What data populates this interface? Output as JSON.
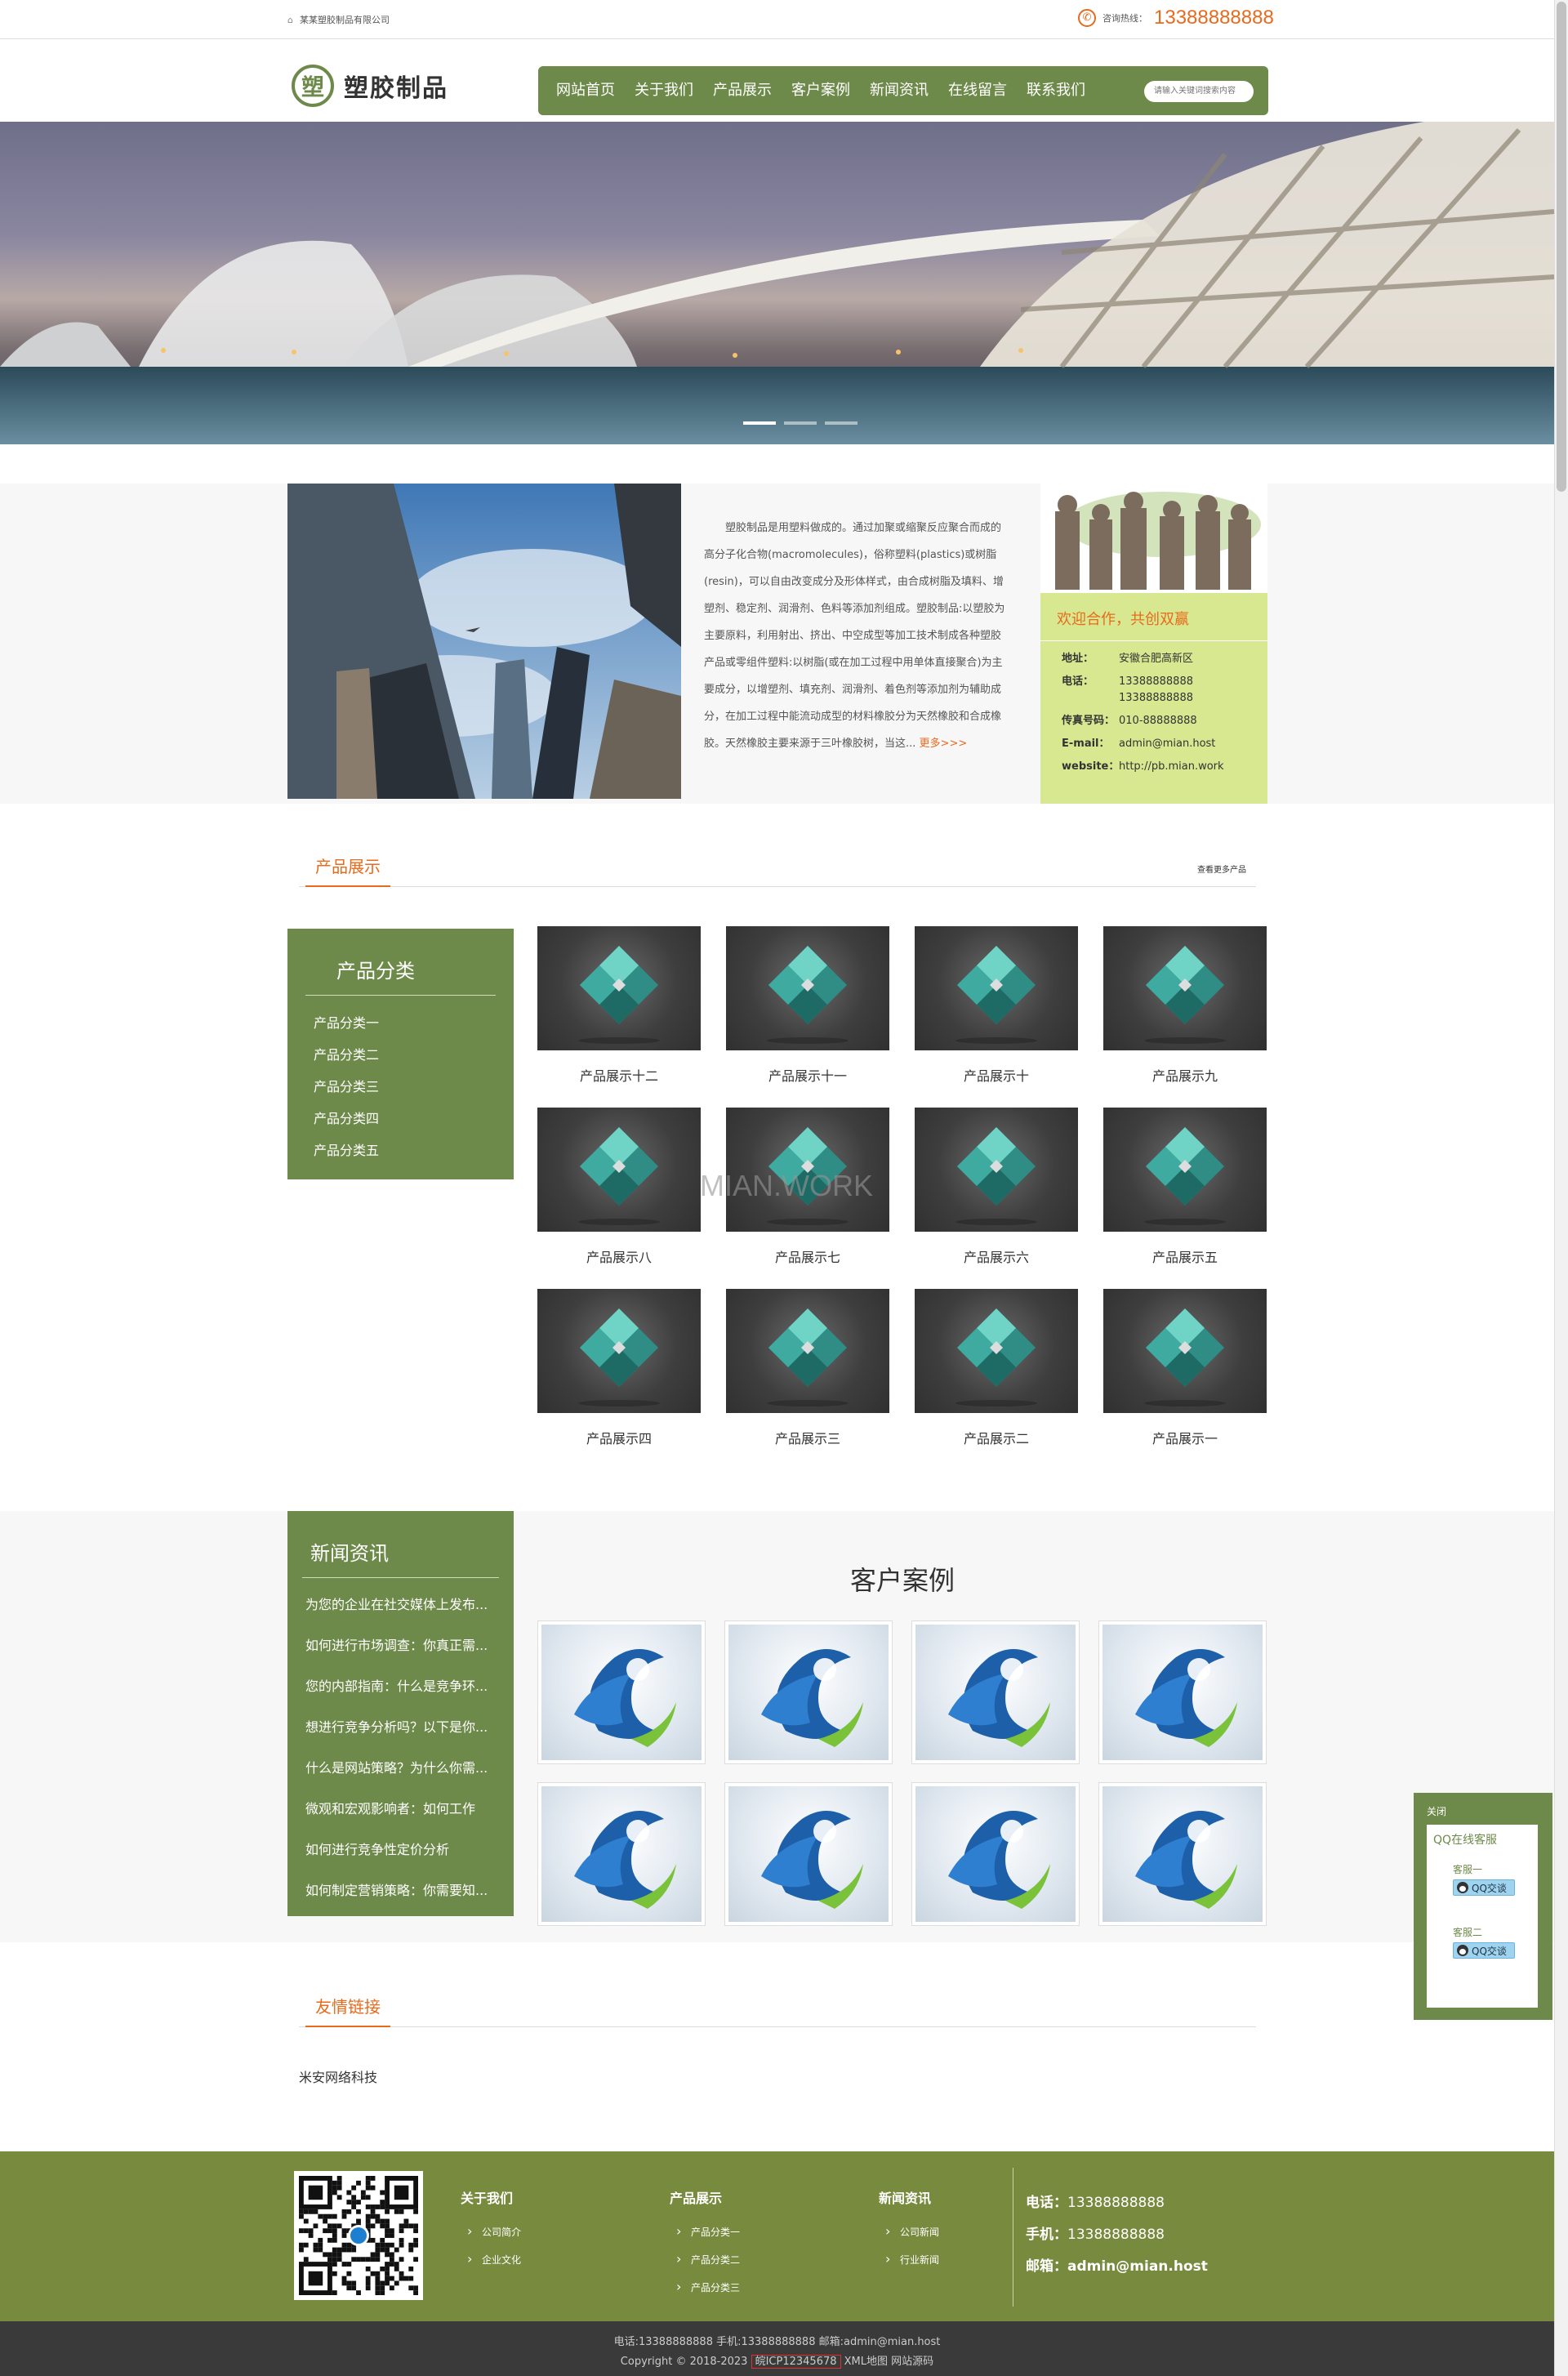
{
  "topbar": {
    "company": "某某塑胶制品有限公司",
    "phone_label": "咨询热线：",
    "phone": "13388888888"
  },
  "header": {
    "logo_mark": "塑",
    "logo_text": "塑胶制品",
    "nav": [
      "网站首页",
      "关于我们",
      "产品展示",
      "客户案例",
      "新闻资讯",
      "在线留言",
      "联系我们"
    ],
    "search_placeholder": "请输入关键词搜索内容"
  },
  "about": {
    "text": "塑胶制品是用塑料做成的。通过加聚或缩聚反应聚合而成的高分子化合物(macromolecules)，俗称塑料(plastics)或树脂(resin)，可以自由改变成分及形体样式，由合成树脂及填料、增塑剂、稳定剂、润滑剂、色料等添加剂组成。塑胶制品:以塑胶为主要原料，利用射出、挤出、中空成型等加工技术制成各种塑胶产品或零组件塑料:以树脂(或在加工过程中用单体直接聚合)为主要成分，以增塑剂、填充剂、润滑剂、着色剂等添加剂为辅助成分，在加工过程中能流动成型的材料橡胶分为天然橡胶和合成橡胶。天然橡胶主要来源于三叶橡胶树，当这...",
    "more": "更多>>>"
  },
  "contact_card": {
    "title": "欢迎合作，共创双赢",
    "rows": [
      {
        "k": "地址：",
        "v": "安徽合肥高新区"
      },
      {
        "k": "电话：",
        "v": "13388888888 13388888888"
      },
      {
        "k": "传真号码：",
        "v": "010-88888888"
      },
      {
        "k": "E-mail：",
        "v": "admin@mian.host"
      },
      {
        "k": "website：",
        "v": "http://pb.mian.work"
      }
    ]
  },
  "products": {
    "title": "产品展示",
    "more": "查看更多产品",
    "category_title": "产品分类",
    "categories": [
      "产品分类一",
      "产品分类二",
      "产品分类三",
      "产品分类四",
      "产品分类五"
    ],
    "items": [
      "产品展示十二",
      "产品展示十一",
      "产品展示十",
      "产品展示九",
      "产品展示八",
      "产品展示七",
      "产品展示六",
      "产品展示五",
      "产品展示四",
      "产品展示三",
      "产品展示二",
      "产品展示一"
    ]
  },
  "watermark": "MIAN.WORK",
  "news": {
    "title": "新闻资讯",
    "items": [
      "为您的企业在社交媒体上发布...",
      "如何进行市场调查：你真正需...",
      "您的内部指南：什么是竞争环...",
      "想进行竞争分析吗？以下是你...",
      "什么是网站策略？为什么你需...",
      "微观和宏观影响者：如何工作",
      "如何进行竞争性定价分析",
      "如何制定营销策略：你需要知..."
    ]
  },
  "cases": {
    "title": "客户案例",
    "count": 8
  },
  "links": {
    "title": "友情链接",
    "items": [
      "米安网络科技"
    ]
  },
  "footer": {
    "cols": [
      {
        "title": "关于我们",
        "links": [
          "公司简介",
          "企业文化"
        ]
      },
      {
        "title": "产品展示",
        "links": [
          "产品分类一",
          "产品分类二",
          "产品分类三"
        ]
      },
      {
        "title": "新闻资讯",
        "links": [
          "公司新闻",
          "行业新闻"
        ]
      }
    ],
    "contact": [
      {
        "k": "电话：",
        "v": "13388888888"
      },
      {
        "k": "手机：",
        "v": "13388888888"
      },
      {
        "k": "邮箱：",
        "v": "admin@mian.host"
      }
    ],
    "bottom_line1": "电话:13388888888  手机:13388888888  邮箱:admin@mian.host",
    "copyright": "Copyright © 2018-2023",
    "icp": "皖ICP12345678",
    "xml": "XML地图",
    "source": "网站源码"
  },
  "qq": {
    "close": "关闭",
    "head": "QQ在线客服",
    "agents": [
      "客服一",
      "客服二"
    ],
    "button": "QQ交谈"
  },
  "colors": {
    "brand_green": "#6e8a4a",
    "accent_orange": "#e86a1c",
    "footer_green": "#778a3e",
    "card_lime": "#d8e891"
  }
}
